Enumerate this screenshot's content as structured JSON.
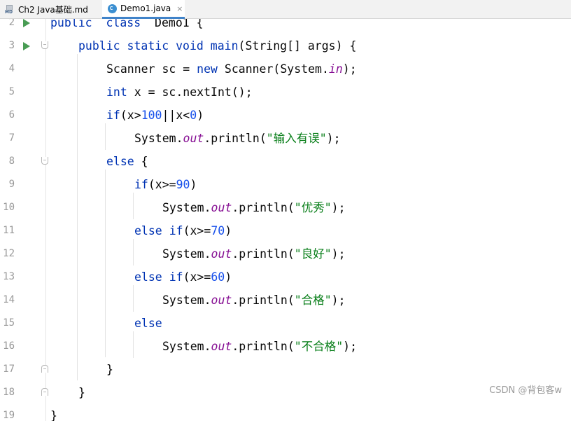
{
  "tabs": [
    {
      "label": "Ch2 Java基础.md",
      "icon": "markdown-file-icon",
      "active": false,
      "icon_text": "MD"
    },
    {
      "label": "Demo1.java",
      "icon": "java-class-icon",
      "active": true,
      "close": "×"
    }
  ],
  "editor": {
    "lines": [
      {
        "number": "2",
        "segments": [
          [
            "kw",
            "public"
          ],
          [
            "",
            "  "
          ],
          [
            "kw",
            "class"
          ],
          [
            "",
            "  Demo1 {"
          ]
        ]
      },
      {
        "number": "3",
        "segments": [
          [
            "kw",
            "public"
          ],
          [
            "",
            " "
          ],
          [
            "kw",
            "static"
          ],
          [
            "",
            " "
          ],
          [
            "kw",
            "void"
          ],
          [
            "",
            " "
          ],
          [
            "kw",
            "main"
          ],
          [
            "",
            "(String[] args) {"
          ]
        ]
      },
      {
        "number": "4",
        "segments": [
          [
            "",
            "Scanner sc = "
          ],
          [
            "kw",
            "new"
          ],
          [
            "",
            " Scanner(System."
          ],
          [
            "fld",
            "in"
          ],
          [
            "",
            ");"
          ]
        ]
      },
      {
        "number": "5",
        "segments": [
          [
            "kw",
            "int"
          ],
          [
            "",
            " x = sc.nextInt();"
          ]
        ]
      },
      {
        "number": "6",
        "segments": [
          [
            "kw",
            "if"
          ],
          [
            "",
            "(x>"
          ],
          [
            "num",
            "100"
          ],
          [
            "",
            "||x<"
          ],
          [
            "num",
            "0"
          ],
          [
            "",
            ")"
          ]
        ]
      },
      {
        "number": "7",
        "segments": [
          [
            "",
            "System."
          ],
          [
            "fld",
            "out"
          ],
          [
            "",
            ".println("
          ],
          [
            "str",
            "\"输入有误\""
          ],
          [
            "",
            ");"
          ]
        ]
      },
      {
        "number": "8",
        "segments": [
          [
            "kw",
            "else"
          ],
          [
            "",
            " {"
          ]
        ]
      },
      {
        "number": "9",
        "segments": [
          [
            "kw",
            "if"
          ],
          [
            "",
            "(x>="
          ],
          [
            "num",
            "90"
          ],
          [
            "",
            ")"
          ]
        ]
      },
      {
        "number": "10",
        "segments": [
          [
            "",
            "System."
          ],
          [
            "fld",
            "out"
          ],
          [
            "",
            ".println("
          ],
          [
            "str",
            "\"优秀\""
          ],
          [
            "",
            ");"
          ]
        ]
      },
      {
        "number": "11",
        "segments": [
          [
            "kw",
            "else"
          ],
          [
            "",
            " "
          ],
          [
            "kw",
            "if"
          ],
          [
            "",
            "(x>="
          ],
          [
            "num",
            "70"
          ],
          [
            "",
            ")"
          ]
        ]
      },
      {
        "number": "12",
        "segments": [
          [
            "",
            "System."
          ],
          [
            "fld",
            "out"
          ],
          [
            "",
            ".println("
          ],
          [
            "str",
            "\"良好\""
          ],
          [
            "",
            ");"
          ]
        ]
      },
      {
        "number": "13",
        "segments": [
          [
            "kw",
            "else"
          ],
          [
            "",
            " "
          ],
          [
            "kw",
            "if"
          ],
          [
            "",
            "(x>="
          ],
          [
            "num",
            "60"
          ],
          [
            "",
            ")"
          ]
        ]
      },
      {
        "number": "14",
        "segments": [
          [
            "",
            "System."
          ],
          [
            "fld",
            "out"
          ],
          [
            "",
            ".println("
          ],
          [
            "str",
            "\"合格\""
          ],
          [
            "",
            ");"
          ]
        ]
      },
      {
        "number": "15",
        "segments": [
          [
            "kw",
            "else"
          ]
        ]
      },
      {
        "number": "16",
        "segments": [
          [
            "",
            "System."
          ],
          [
            "fld",
            "out"
          ],
          [
            "",
            ".println("
          ],
          [
            "str",
            "\"不合格\""
          ],
          [
            "",
            ");"
          ]
        ]
      },
      {
        "number": "17",
        "segments": [
          [
            "",
            "}"
          ]
        ]
      },
      {
        "number": "18",
        "segments": [
          [
            "",
            "}"
          ]
        ]
      },
      {
        "number": "19",
        "segments": [
          [
            "",
            "}"
          ]
        ]
      }
    ]
  },
  "watermark": "CSDN @背包客w",
  "colors": {
    "keyword": "#0033b3",
    "number": "#1750eb",
    "string": "#067d17",
    "field": "#871094",
    "run_icon": "#499c54",
    "active_tab_underline": "#4083c9"
  }
}
